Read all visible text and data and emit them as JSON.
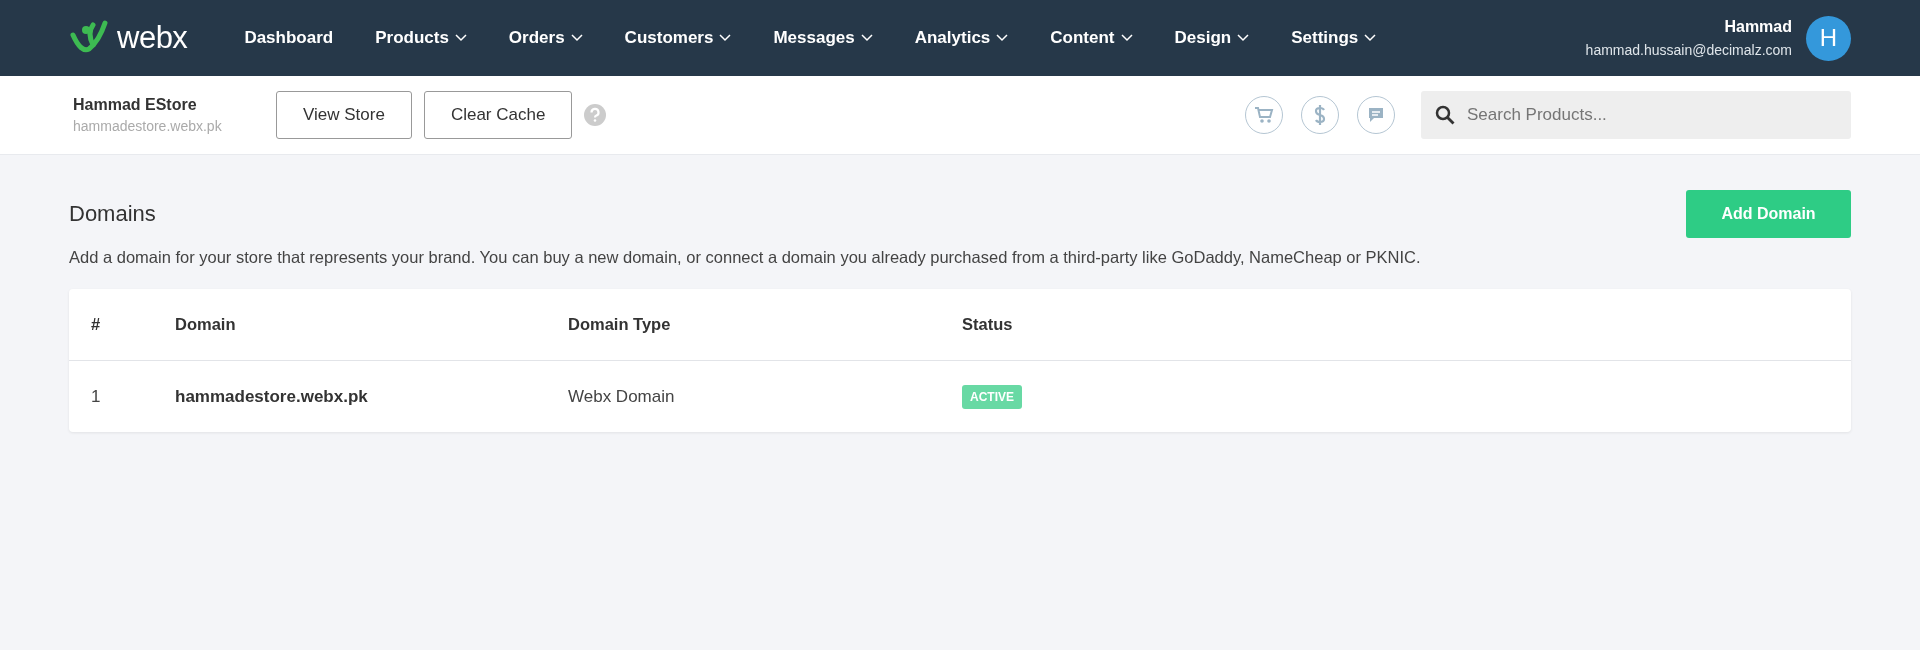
{
  "topbar": {
    "logo": "webx",
    "nav": [
      {
        "label": "Dashboard",
        "dropdown": false
      },
      {
        "label": "Products",
        "dropdown": true
      },
      {
        "label": "Orders",
        "dropdown": true
      },
      {
        "label": "Customers",
        "dropdown": true
      },
      {
        "label": "Messages",
        "dropdown": true
      },
      {
        "label": "Analytics",
        "dropdown": true
      },
      {
        "label": "Content",
        "dropdown": true
      },
      {
        "label": "Design",
        "dropdown": true
      },
      {
        "label": "Settings",
        "dropdown": true
      }
    ],
    "user": {
      "name": "Hammad",
      "email": "hammad.hussain@decimalz.com",
      "initial": "H"
    }
  },
  "store_bar": {
    "store_name": "Hammad EStore",
    "store_url": "hammadestore.webx.pk",
    "buttons": [
      "View Store",
      "Clear Cache"
    ],
    "search": {
      "placeholder": "Search Products..."
    }
  },
  "page": {
    "title": "Domains",
    "description": "Add a domain for your store that represents your brand. You can buy a new domain, or connect a domain you already purchased from a third-party like GoDaddy, NameCheap or PKNIC.",
    "add_button": "Add Domain",
    "table": {
      "columns": [
        "#",
        "Domain",
        "Domain Type",
        "Status"
      ],
      "rows": [
        {
          "index": "1",
          "domain": "hammadestore.webx.pk",
          "type": "Webx Domain",
          "status": "ACTIVE",
          "color": "#68d9a4"
        }
      ]
    }
  }
}
